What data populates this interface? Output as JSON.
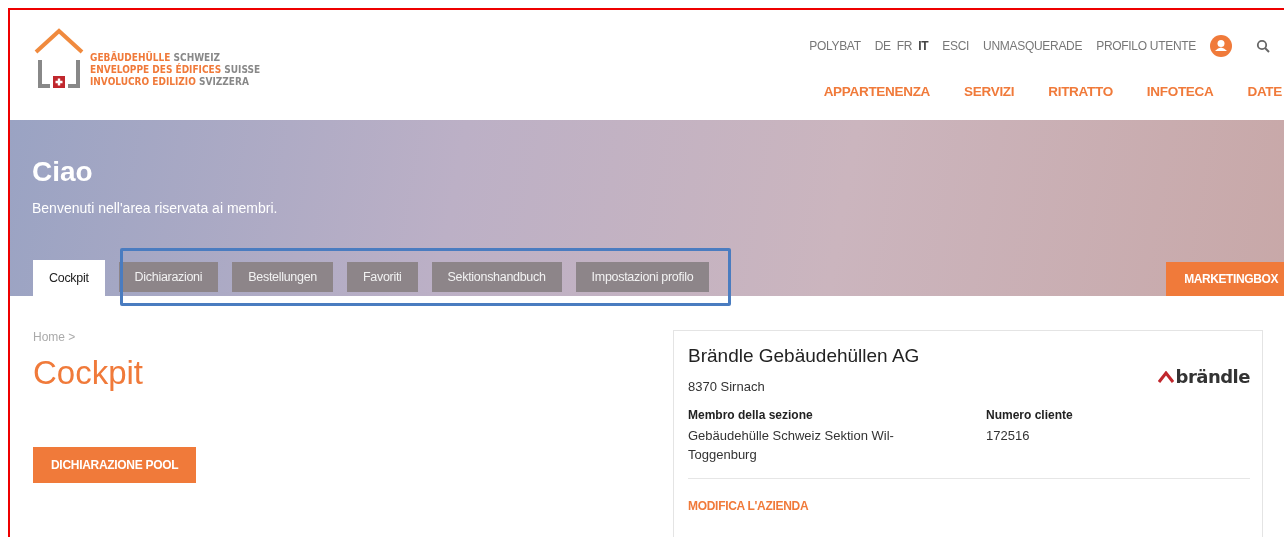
{
  "logo": {
    "lines": [
      {
        "primary": "GEBÄUDEHÜLLE",
        "secondary": "SCHWEIZ"
      },
      {
        "primary": "ENVELOPPE DES ÉDIFICES",
        "secondary": "SUISSE"
      },
      {
        "primary": "INVOLUCRO EDILIZIO",
        "secondary": "SVIZZERA"
      }
    ]
  },
  "top_links": [
    {
      "label": "POLYBAT"
    }
  ],
  "languages": [
    {
      "label": "DE",
      "selected": false
    },
    {
      "label": "FR",
      "selected": false
    },
    {
      "label": "IT",
      "selected": true
    }
  ],
  "account_links": [
    {
      "label": "ESCI"
    },
    {
      "label": "UNMASQUERADE"
    }
  ],
  "profile": {
    "label": "PROFILO UTENTE"
  },
  "main_nav": [
    {
      "label": "APPARTENENZA"
    },
    {
      "label": "SERVIZI"
    },
    {
      "label": "RITRATTO"
    },
    {
      "label": "INFOTECA"
    },
    {
      "label": "DATE"
    }
  ],
  "hero": {
    "title": "Ciao",
    "subtitle": "Benvenuti nell'area riservata ai membri."
  },
  "tabs": [
    {
      "label": "Cockpit",
      "selected": true
    },
    {
      "label": "Dichiarazioni",
      "selected": false
    },
    {
      "label": "Bestellungen",
      "selected": false
    },
    {
      "label": "Favoriti",
      "selected": false
    },
    {
      "label": "Sektionshandbuch",
      "selected": false
    },
    {
      "label": "Impostazioni profilo",
      "selected": false
    }
  ],
  "marketing_button": "MARKETINGBOX",
  "breadcrumb": "Home >",
  "page_title": "Cockpit",
  "pool_button": "DICHIARAZIONE POOL",
  "company": {
    "name": "Brändle Gebäudehüllen AG",
    "address": "8370 Sirnach",
    "logo_text": "brändle",
    "fields": [
      {
        "label": "Membro della sezione",
        "value": "Gebäudehülle Schweiz Sektion Wil-Toggenburg"
      },
      {
        "label": "Numero cliente",
        "value": "172516"
      }
    ],
    "edit_link": "MODIFICA L'AZIENDA"
  }
}
